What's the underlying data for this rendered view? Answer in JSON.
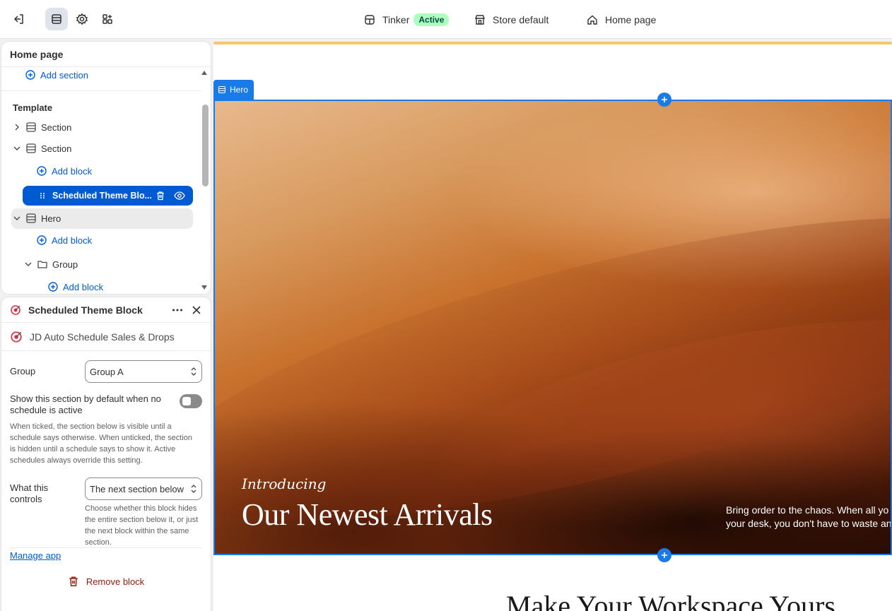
{
  "topbar": {
    "theme_name": "Tinker",
    "theme_status": "Active",
    "store": "Store default",
    "page": "Home page"
  },
  "tree": {
    "title": "Home page",
    "add_section": "Add section",
    "template_label": "Template",
    "rows": [
      {
        "label": "Section"
      },
      {
        "label": "Section"
      },
      {
        "label": "Add block"
      },
      {
        "label": "Scheduled Theme Blo..."
      },
      {
        "label": "Hero"
      },
      {
        "label": "Add block"
      },
      {
        "label": "Group"
      },
      {
        "label": "Add block"
      }
    ]
  },
  "block_panel": {
    "title": "Scheduled Theme Block",
    "app_name": "JD Auto Schedule Sales & Drops",
    "group_label": "Group",
    "group_value": "Group A",
    "default_label": "Show this section by default when no schedule is active",
    "default_help": "When ticked, the section below is visible until a schedule says otherwise. When unticked, the section is hidden until a schedule says to show it. Active schedules always override this setting.",
    "default_on": false,
    "controls_label": "What this controls",
    "controls_value": "The next section below",
    "controls_help": "Choose whether this block hides the entire section below it, or just the next block within the same section.",
    "manage_app": "Manage app",
    "remove_block": "Remove block"
  },
  "preview": {
    "hero_tag": "Hero",
    "hero_intro": "Introducing",
    "hero_title": "Our Newest Arrivals",
    "hero_desc_line1": "Bring order to the chaos. When all yo",
    "hero_desc_line2": "your desk, you don't have to waste an",
    "next_title": "Make Your Workspace Yours"
  },
  "colors": {
    "accent": "#005bd3",
    "selection_outline": "#1a7ae8",
    "badge_bg": "#affebf",
    "danger": "#8e1f0b"
  }
}
